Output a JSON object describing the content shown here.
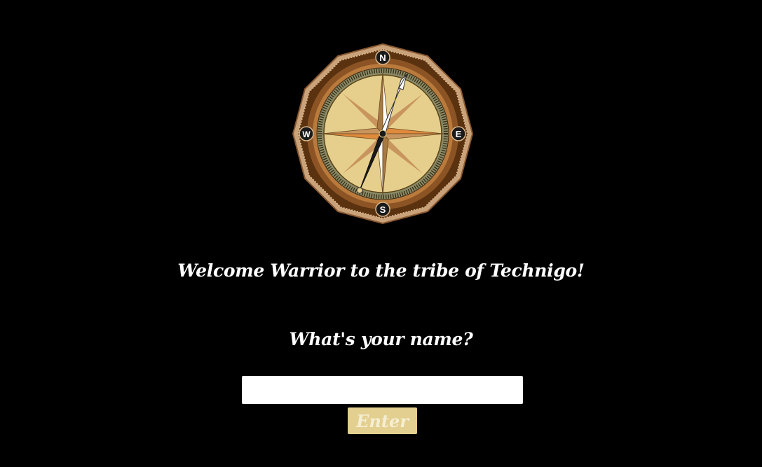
{
  "compass": {
    "icon": "compass-icon",
    "north": "N",
    "south": "S",
    "east": "E",
    "west": "W"
  },
  "welcome": {
    "text": "Welcome Warrior to the tribe of Technigo!"
  },
  "form": {
    "question": "What's your name?",
    "input_value": "",
    "input_placeholder": "",
    "button_label": "Enter"
  },
  "colors": {
    "background": "#000000",
    "text": "#ffffff",
    "button_bg": "#e3cf8f",
    "button_text": "#f6eed2"
  }
}
